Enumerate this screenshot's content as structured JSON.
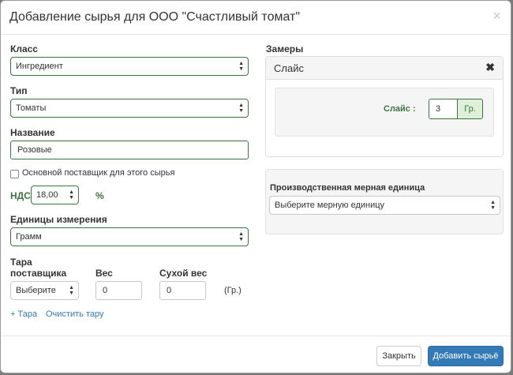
{
  "modal": {
    "title": "Добавление сырья для ООО \"Счастливый томат\"",
    "close_symbol": "×"
  },
  "form": {
    "class_label": "Класс",
    "class_value": "Ингредиент",
    "type_label": "Тип",
    "type_value": "Томаты",
    "name_label": "Название",
    "name_value": "Розовые",
    "main_supplier_label": "Основной поставщик для этого сырья",
    "main_supplier_checked": false,
    "vat_label": "НДС",
    "vat_value": "18,00",
    "vat_unit": "%",
    "units_label": "Единицы измерения",
    "units_value": "Грамм",
    "tare_label_line1": "Тара",
    "tare_label_line2": "поставщика",
    "tare_select_value": "Выберите",
    "weight_label": "Вес",
    "weight_value": "0",
    "dry_weight_label": "Сухой вес",
    "dry_weight_value": "0",
    "weight_unit": "(Гр.)",
    "add_tare_link": "+ Тара",
    "clear_tare_link": "Очистить тару"
  },
  "measurements": {
    "label": "Замеры",
    "slice_panel_title": "Слайс",
    "slice_remove_symbol": "✖",
    "slice_field_label": "Слайс :",
    "slice_value": "3",
    "slice_unit": "Гр."
  },
  "production_unit": {
    "label": "Производственная мерная единица",
    "select_placeholder": "Выберите мерную единицу"
  },
  "footer": {
    "close_button": "Закрыть",
    "submit_button": "Добавить сырьё"
  },
  "colors": {
    "accent_green": "#3c763d",
    "primary_blue": "#337ab7",
    "link_blue": "#337ab7"
  }
}
